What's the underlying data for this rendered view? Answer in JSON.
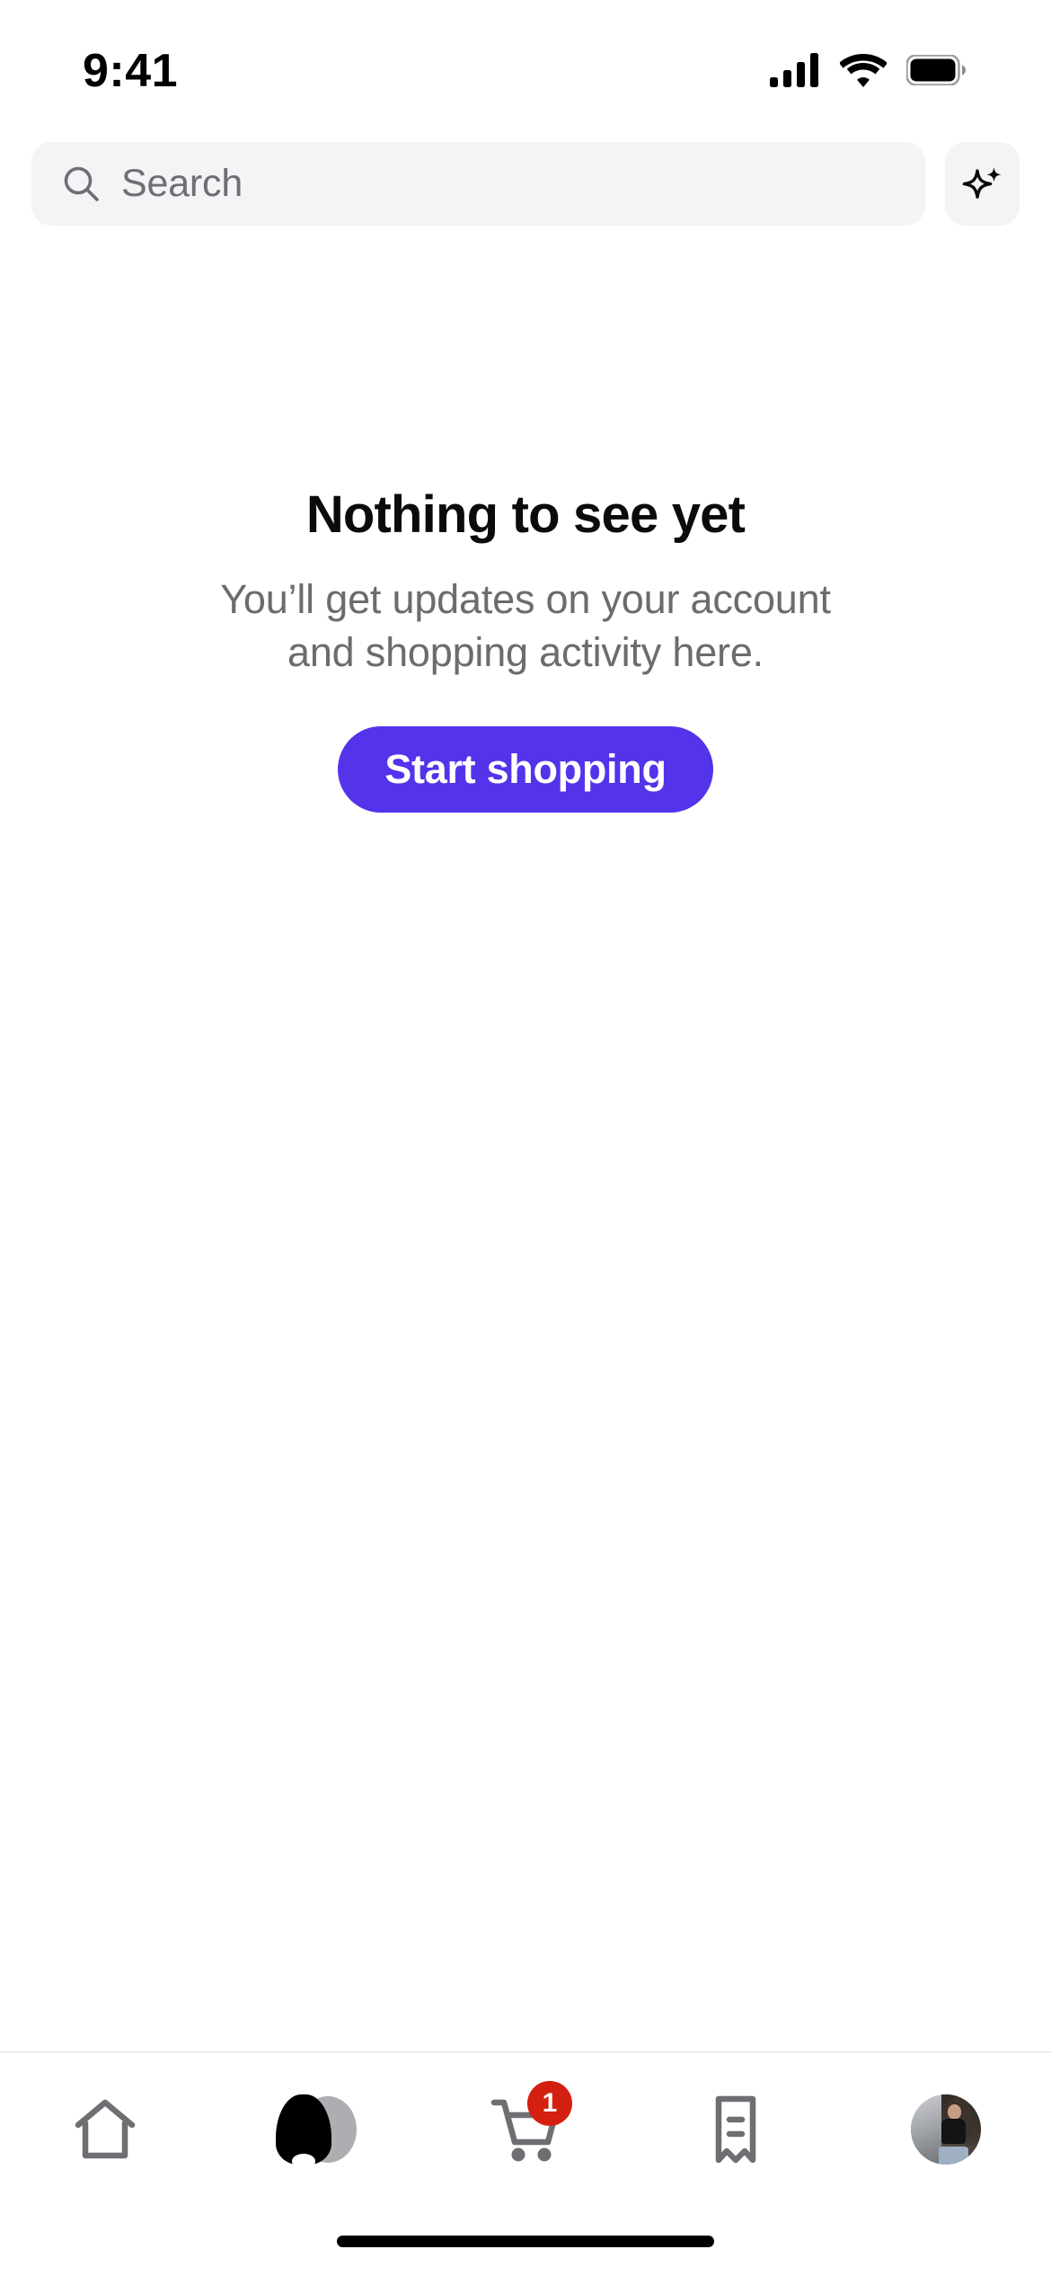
{
  "status_bar": {
    "time": "9:41",
    "cellular_icon": "cellular-signal-icon",
    "wifi_icon": "wifi-icon",
    "battery_icon": "battery-full-icon"
  },
  "search": {
    "placeholder": "Search",
    "search_icon": "search-icon",
    "ai_button_icon": "sparkle-ai-icon"
  },
  "empty_state": {
    "title": "Nothing to see yet",
    "subtitle": "You’ll get updates on your account and shopping activity here.",
    "cta_label": "Start shopping"
  },
  "tab_bar": {
    "tabs": [
      {
        "name": "home",
        "icon": "home-icon",
        "badge": ""
      },
      {
        "name": "shop",
        "icon": "shop-dress-icon",
        "badge": ""
      },
      {
        "name": "cart",
        "icon": "shopping-cart-icon",
        "badge": "1"
      },
      {
        "name": "orders",
        "icon": "receipt-icon",
        "badge": ""
      },
      {
        "name": "profile",
        "icon": "avatar-icon",
        "badge": ""
      }
    ]
  },
  "colors": {
    "accent": "#5433eb",
    "badge": "#d32011",
    "field_bg": "#f4f4f6",
    "title": "#0b0b0d",
    "subtitle": "#6b6b70",
    "icon_gray": "#6e6e73"
  }
}
